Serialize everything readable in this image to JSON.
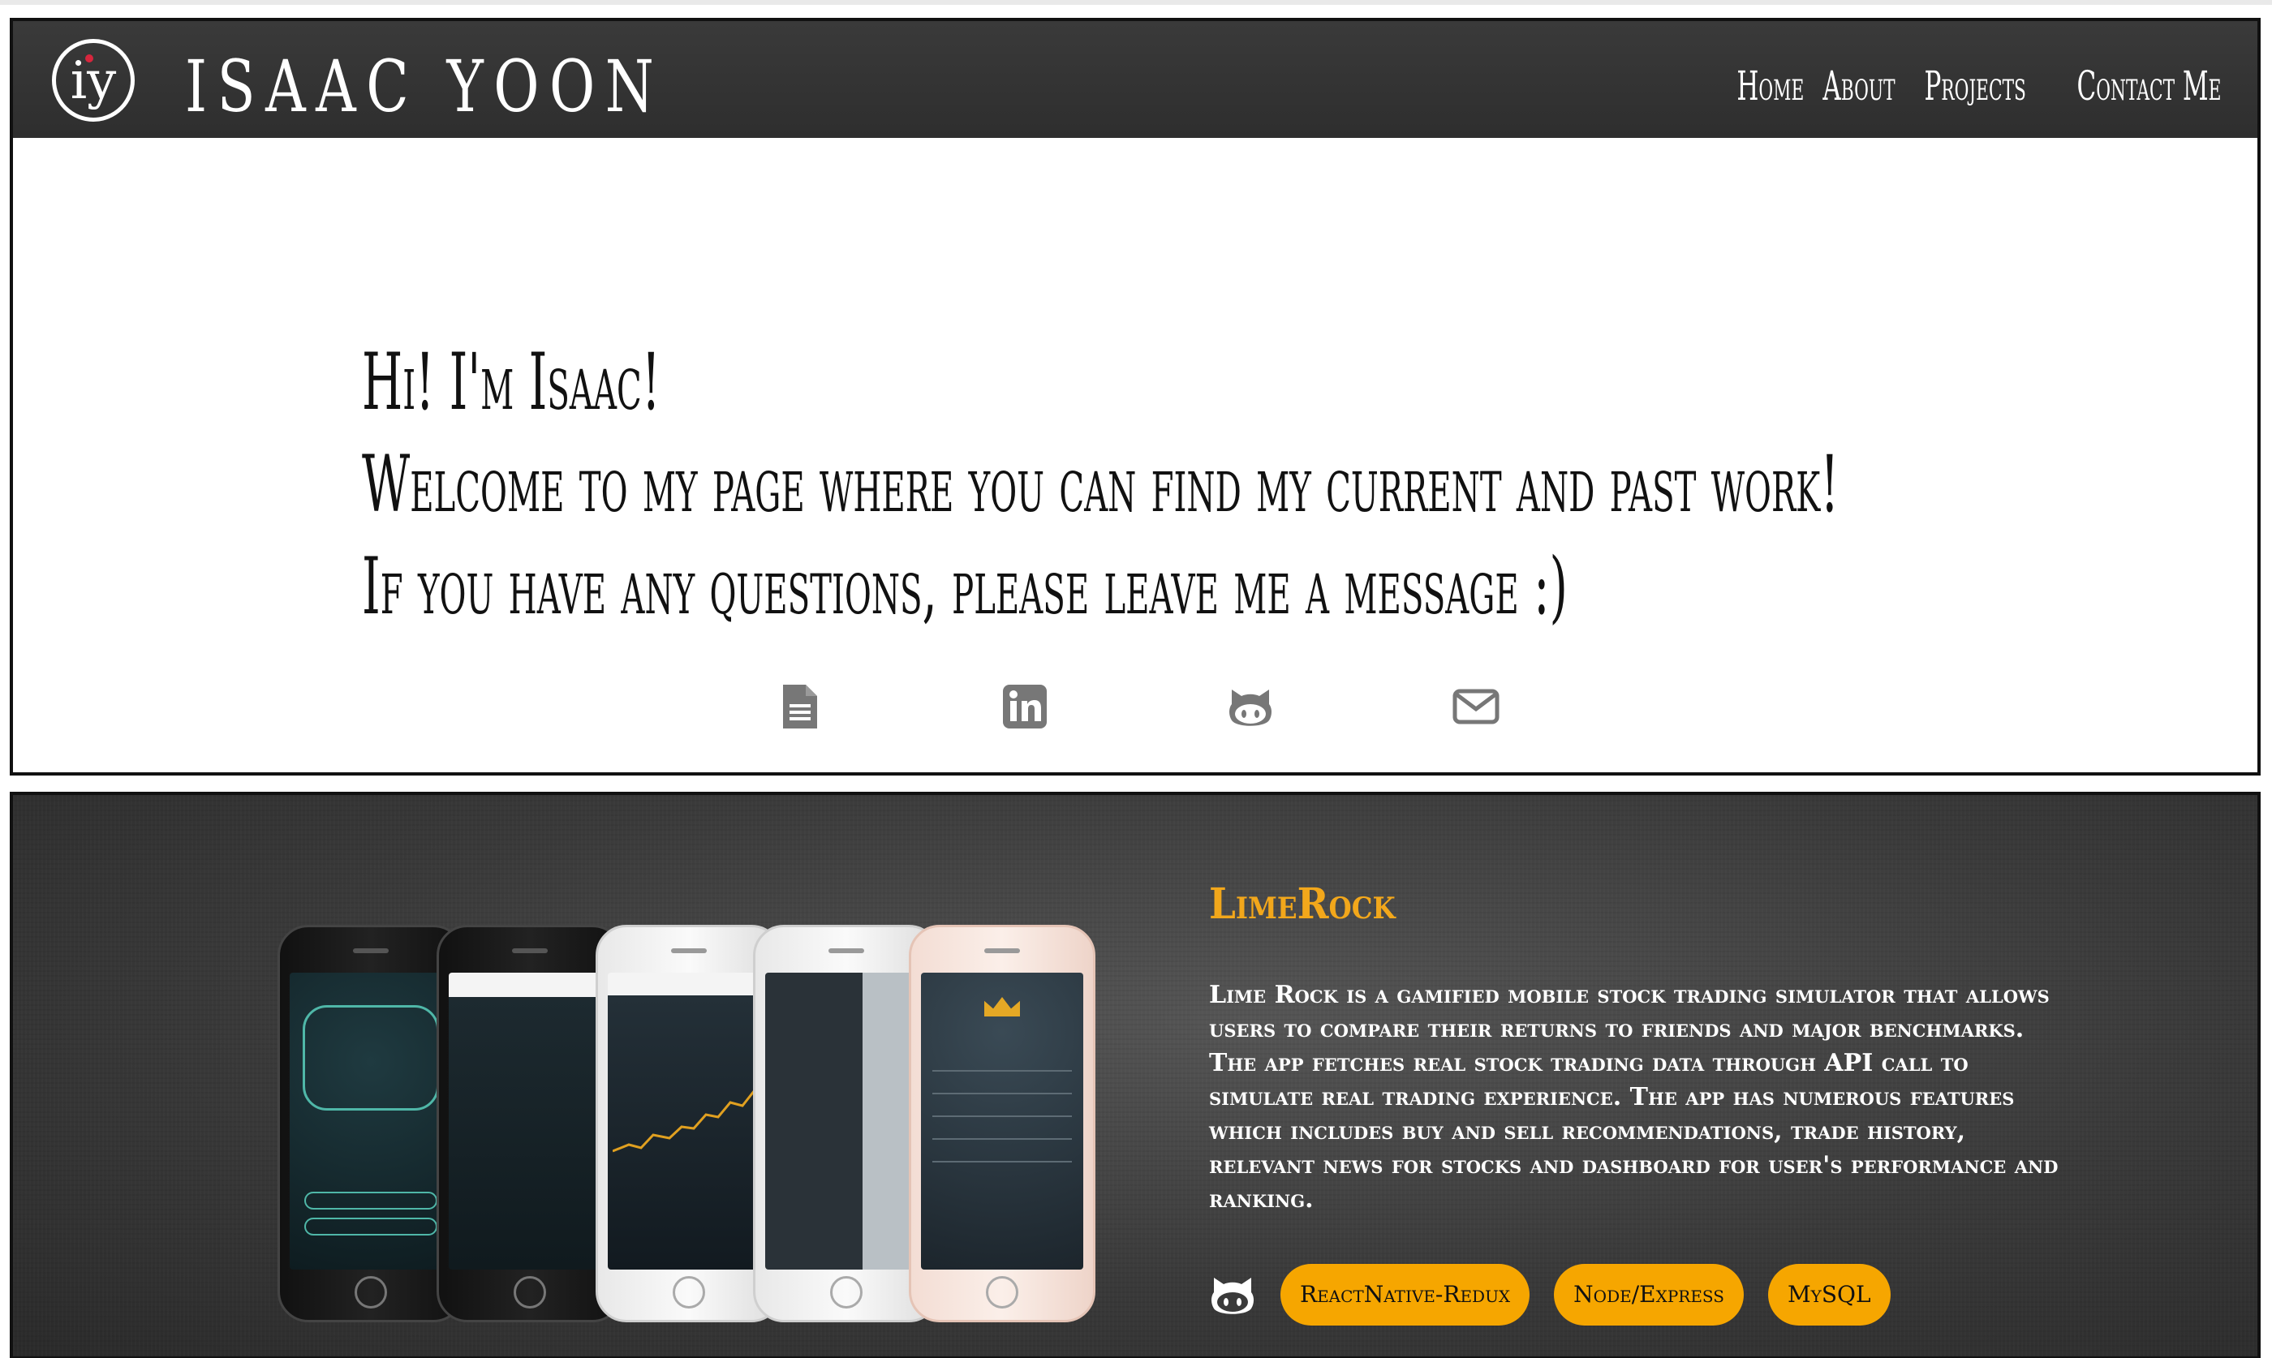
{
  "header": {
    "logo_text": "iy",
    "title": "ISAAC YOON",
    "nav": [
      "Home",
      "About",
      "Projects",
      "Contact Me"
    ]
  },
  "intro": {
    "lines": [
      "Hi! I'm Isaac!",
      "Welcome to my page where you can find my current and past work!",
      "If you have any questions, please leave me a message :)"
    ],
    "social_icons": [
      "resume-icon",
      "linkedin-icon",
      "github-icon",
      "email-icon"
    ]
  },
  "project": {
    "title": "LimeRock",
    "description": "Lime Rock is a gamified mobile stock trading simulator that allows users to compare their returns to friends and major benchmarks. The app fetches real stock trading data through API call to simulate real trading experience. The app has numerous features which includes buy and sell recommendations, trade history, relevant news for stocks and dashboard for user's performance and ranking.",
    "tags": [
      "ReactNative-Redux",
      "Node/Express",
      "MySQL"
    ],
    "icon": "github-icon"
  },
  "colors": {
    "accent": "#f2a71b",
    "tag_bg": "#f6a600",
    "header_bg": "#333333"
  }
}
